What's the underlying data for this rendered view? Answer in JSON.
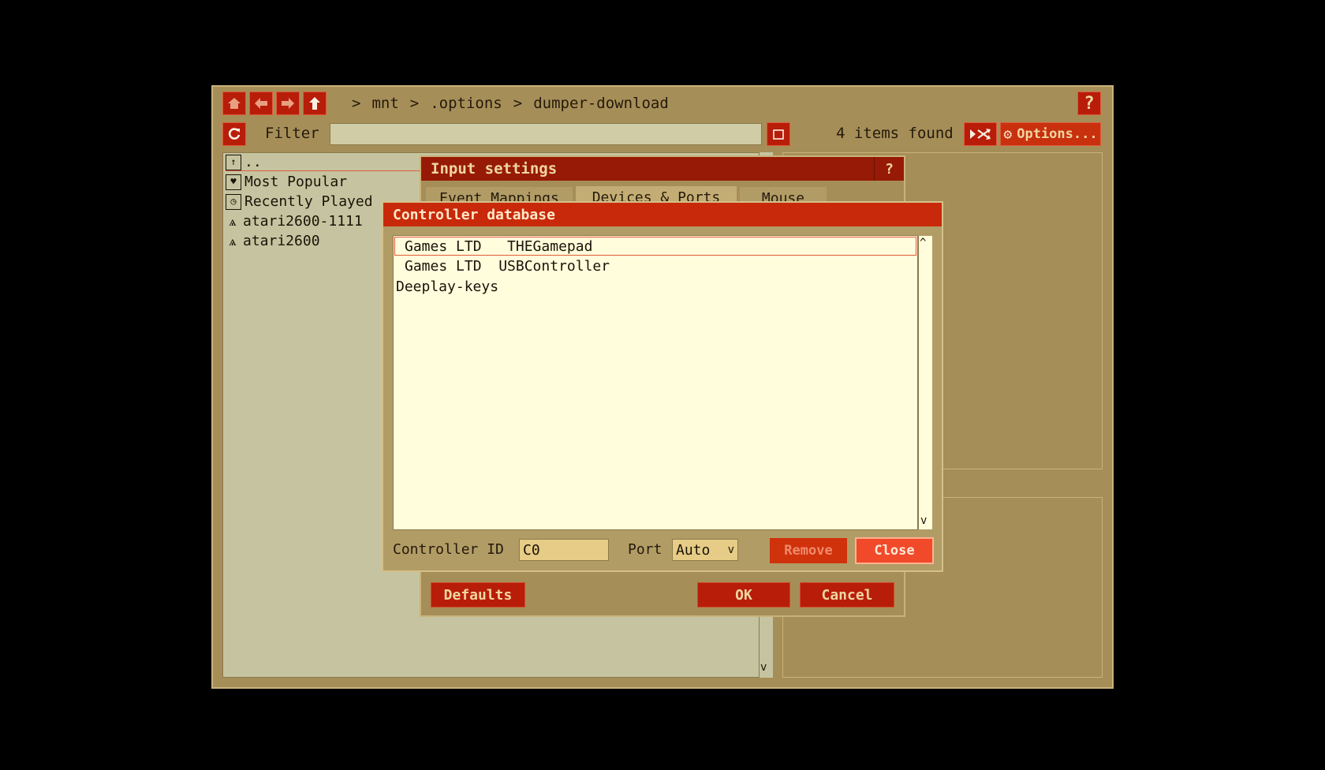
{
  "breadcrumb": {
    "sep": ">",
    "items": [
      "mnt",
      ".options",
      "dumper-download"
    ]
  },
  "toolbar": {
    "filter_label": "Filter",
    "filter_value": "",
    "items_found": "4 items found",
    "options_label": "Options...",
    "help_label": "?"
  },
  "file_list": {
    "parent": "..",
    "items": [
      {
        "label": "Most Popular",
        "icon": "heart-icon"
      },
      {
        "label": "Recently Played",
        "icon": "clock-icon"
      },
      {
        "label": "atari2600-1111",
        "icon": "atari-icon"
      },
      {
        "label": "atari2600",
        "icon": "atari-icon"
      }
    ]
  },
  "input_settings": {
    "title": "Input settings",
    "help_label": "?",
    "tabs": [
      "Event Mappings",
      "Devices & Ports",
      "Mouse"
    ],
    "defaults_label": "Defaults",
    "ok_label": "OK",
    "cancel_label": "Cancel"
  },
  "controller_db": {
    "title": "Controller database",
    "rows": [
      "Games LTD   THEGamepad",
      "Games LTD  USBController",
      "Deeplay-keys"
    ],
    "controller_id_label": "Controller ID",
    "controller_id_value": "C0",
    "port_label": "Port",
    "port_value": "Auto",
    "remove_label": "Remove",
    "close_label": "Close"
  },
  "colors": {
    "accent": "#b81d0a",
    "title_bar": "#c8290a",
    "window_bg": "#a68e58"
  }
}
